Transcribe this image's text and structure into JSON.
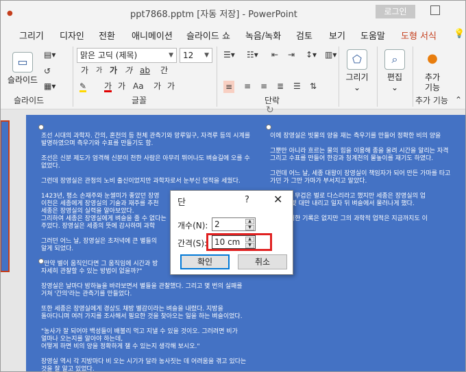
{
  "titlebar": {
    "title": "ppt7868.pptm [자동 저장]  -  PowerPoint",
    "login_label": "로그인"
  },
  "tabs": [
    {
      "label": "그리기"
    },
    {
      "label": "디자인"
    },
    {
      "label": "전환"
    },
    {
      "label": "애니메이션"
    },
    {
      "label": "슬라이드 쇼"
    },
    {
      "label": "녹음/녹화"
    },
    {
      "label": "검토"
    },
    {
      "label": "보기"
    },
    {
      "label": "도움말"
    },
    {
      "label": "도형 서식",
      "active": true
    }
  ],
  "ribbon": {
    "slide_new_label": "슬라이드",
    "slide_group_label": "슬라이드",
    "font_name": "맑은 고딕 (제목)",
    "font_size": "12",
    "font_buttons": [
      "가",
      "가",
      "가",
      "가",
      "ab",
      "간"
    ],
    "format_buttons": [
      "가",
      "가",
      "Aa",
      "가",
      "가"
    ],
    "font_group_label": "글꼴",
    "para_group_label": "단락",
    "draw_label": "그리기",
    "edit_label": "편집",
    "addin_label_1": "추가",
    "addin_label_2": "기능",
    "addin_group_label": "추가 기능"
  },
  "slide_text": {
    "left_column": "조선 시대의 과학자. 간의, 혼천의 등 천체 관측기와 망루일구, 자격루 등의 시계를\n발명하였으며   측우기와 수표를 만들기도 함.\n\n조선은 신분 제도가 엄격해 신분이 천한 사람은 아무리 뛰어나도 벼슬길에 오를 수\n없었다.\n\n그런데 장영실은 관청의 노비 출신이었지만 과학자로서 눈부신 업적을 세웠다.\n\n1423년, 평소 손재주와 눈썰미가 좋았던 장영\n 이천은 세종에게 장영실의 기술과 재주를 추천\n세종은 장영실의 실력을 알아보았다.\n그리하여 세종은 장영실에게 벼슬을 줄 수 없다는\n주었다. 장영실은 세종의 뜻에 감사하며 과학\n\n그러던 어느 날, 장영실은 초저녁에 큰 별들의\n알게 되었다.\n\n\"만약 별이 움직인다면 그 움직임에 시간과 방\n자세히 관찰할 수 있는 방법이 없을까?\"\n\n장영실은 날마다 밤하늘을 바라보면서 별들을 관찰했다. 그리고 몇 번의 실패를\n거쳐 '간의'라는 관측기를 만들었다.\n\n또한 세종은 장영실에게 경상도 채방 별감이라는 벼슬을 내렸다. 지방을\n돌아다니며 여러 가지를 조사해서 필요한 것을 찾아오는 일을 하는 벼슬이었다.\n\n\"농사가 잘 되어야 백성들이 배불리 먹고 지낼 수 있을 것이오. 그러려면 비가\n얼마나 오는지를 알아야 하는데,\n어떻게 하면 비의 양을 정확하게 잴 수 있는지 생각해 보시오.\"\n\n장영실 역시 각 지방마다 비 오는 시기가 달라 농사짓는 데 어려움을 겪고 있다는\n것을 잘 알고 있었다.",
    "right_column": "이에 장영실은 빗물의 양을 재는 측우기를 만들어 정확한 비의 양을\n\n그뿐만 아니라 흐르는 물의 힘을 이용해 종을 울려 시간을 알리는 자격\n그리고 수표를 만들어 한강과 청계천의 물높이를 재기도 하였다.\n\n그런데 어느 날, 세종 대왕이 장영실이 책임자가 되어 만든 가마를 타고\n가던 가 그만 가마가 부서지고 말았다.\n\n장영실을 무겁은 벌로 다스리라고 했지만 세종은 장영실의 업\n을 조금 몇 대만 내리고 일자 뒤 벼슬에서 물러나게 했다.\n\n영실에 대한 기록은 없지만 그의 과학적 업적은 지금까지도 이"
  },
  "dialog": {
    "title": "단",
    "help": "?",
    "close": "✕",
    "count_label": "개수(N):",
    "count_value": "2",
    "spacing_label": "간격(S):",
    "spacing_value": "10 cm",
    "ok_label": "확인",
    "cancel_label": "취소"
  },
  "colors": {
    "accent": "#c43e1c",
    "slide_bg": "#4472c4",
    "highlight": "#e02020"
  }
}
